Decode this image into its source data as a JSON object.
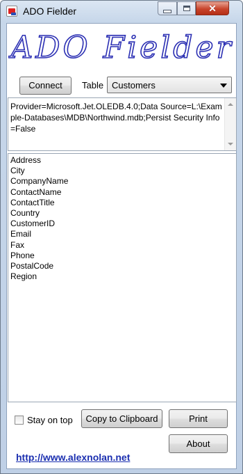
{
  "window": {
    "title": "ADO Fielder"
  },
  "banner": {
    "text": "ADO Fielder"
  },
  "toolbar": {
    "connect_label": "Connect",
    "table_label": "Table",
    "table_selected": "Customers"
  },
  "connection": {
    "text": "Provider=Microsoft.Jet.OLEDB.4.0;Data Source=L:\\Example-Databases\\MDB\\Northwind.mdb;Persist Security Info=False"
  },
  "fields": [
    "Address",
    "City",
    "CompanyName",
    "ContactName",
    "ContactTitle",
    "Country",
    "CustomerID",
    "Email",
    "Fax",
    "Phone",
    "PostalCode",
    "Region"
  ],
  "footer": {
    "stay_on_top_label": "Stay on top",
    "stay_on_top_checked": false,
    "copy_label": "Copy to Clipboard",
    "print_label": "Print",
    "about_label": "About",
    "url": "http://www.alexnolan.net"
  },
  "icons": [
    "app-icon",
    "minimize-icon",
    "maximize-icon",
    "close-icon",
    "dropdown-arrow-icon",
    "scroll-up-icon",
    "scroll-down-icon"
  ],
  "colors": {
    "banner_text": "#2b2fb3",
    "link": "#1b2fb0",
    "close_button": "#c8442b"
  }
}
